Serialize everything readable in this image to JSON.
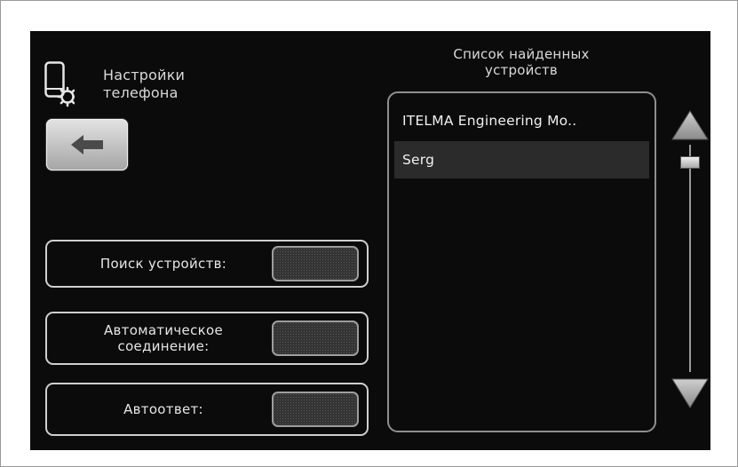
{
  "header": {
    "title": "Настройки\nтелефона",
    "phone_icon": "phone-gear-icon",
    "back_icon": "arrow-left-icon"
  },
  "toggles": [
    {
      "label": "Поиск устройств:",
      "state": "off"
    },
    {
      "label": "Автоматическое\nсоединение:",
      "state": "off"
    },
    {
      "label": "Автоответ:",
      "state": "off"
    }
  ],
  "device_list": {
    "title": "Список найденных\nустройств",
    "items": [
      {
        "name": "ITELMA Engineering Mo.."
      },
      {
        "name": "Serg",
        "selected": true
      }
    ]
  },
  "scrollbar": {
    "up_icon": "triangle-up-icon",
    "down_icon": "triangle-down-icon"
  },
  "colors": {
    "background": "#0b0b0b",
    "text": "#e6e6e6",
    "border": "#cfcfcf",
    "selected_row": "#2b2b2b"
  }
}
